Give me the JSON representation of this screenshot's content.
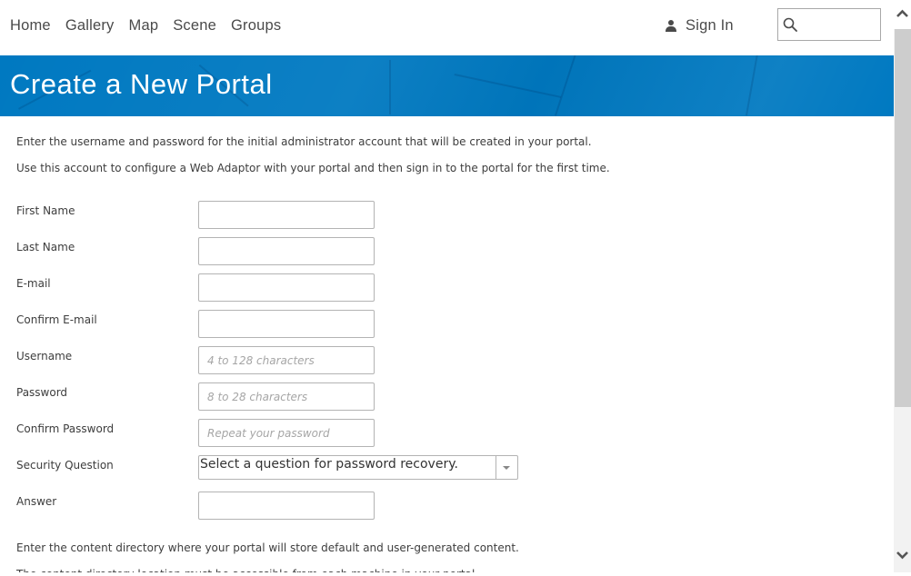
{
  "nav": {
    "links": [
      {
        "label": "Home"
      },
      {
        "label": "Gallery"
      },
      {
        "label": "Map"
      },
      {
        "label": "Scene"
      },
      {
        "label": "Groups"
      }
    ],
    "sign_in_label": "Sign In",
    "search": {
      "value": "",
      "placeholder": ""
    }
  },
  "banner": {
    "title": "Create a New Portal",
    "color": "#0079c1"
  },
  "intro": {
    "line1": "Enter the username and password for the initial administrator account that will be created in your portal.",
    "line2": "Use this account to configure a Web Adaptor with your portal and then sign in to the portal for the first time."
  },
  "form": {
    "first_name": {
      "label": "First Name",
      "value": "",
      "placeholder": ""
    },
    "last_name": {
      "label": "Last Name",
      "value": "",
      "placeholder": ""
    },
    "email": {
      "label": "E-mail",
      "value": "",
      "placeholder": ""
    },
    "confirm_email": {
      "label": "Confirm E-mail",
      "value": "",
      "placeholder": ""
    },
    "username": {
      "label": "Username",
      "value": "",
      "placeholder": "4 to 128 characters"
    },
    "password": {
      "label": "Password",
      "value": "",
      "placeholder": "8 to 28 characters"
    },
    "confirm_password": {
      "label": "Confirm Password",
      "value": "",
      "placeholder": "Repeat your password"
    },
    "security_question": {
      "label": "Security Question",
      "selected": "Select a question for password recovery."
    },
    "answer": {
      "label": "Answer",
      "value": "",
      "placeholder": ""
    }
  },
  "content_directory": {
    "line1": "Enter the content directory where your portal will store default and user-generated content.",
    "line2": "The content directory location must be accessible from each machine in your portal."
  }
}
